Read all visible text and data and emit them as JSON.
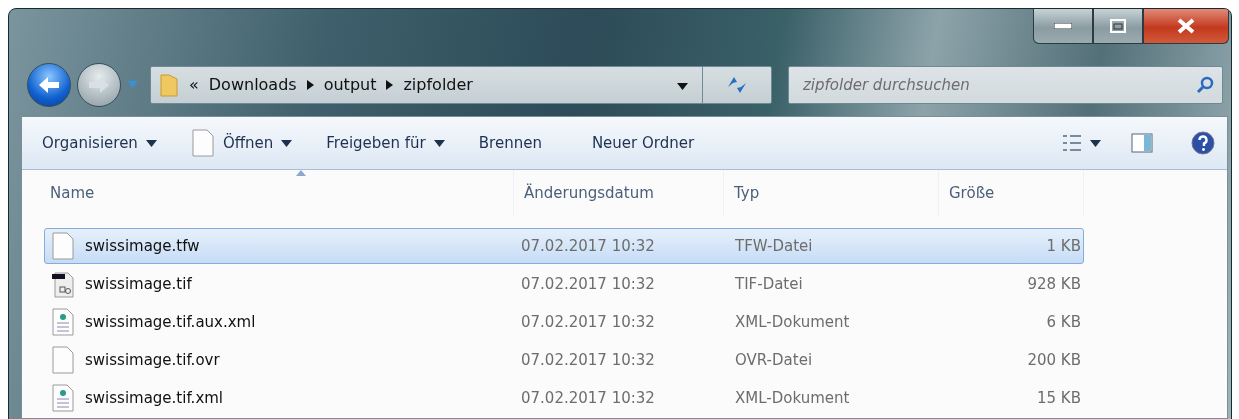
{
  "address_bar": {
    "overflow": "«",
    "path": [
      "Downloads",
      "output",
      "zipfolder"
    ]
  },
  "search": {
    "placeholder": "zipfolder durchsuchen"
  },
  "toolbar": [
    {
      "kind": "menu",
      "label": "Organisieren"
    },
    {
      "kind": "open",
      "label": "Öffnen"
    },
    {
      "kind": "menu",
      "label": "Freigeben für"
    },
    {
      "kind": "plain",
      "label": "Brennen"
    },
    {
      "kind": "plain",
      "label": "Neuer Ordner"
    }
  ],
  "table": {
    "columns": [
      "Name",
      "Änderungsdatum",
      "Typ",
      "Größe"
    ],
    "rows": [
      {
        "kind": "blank",
        "name": "swissimage.tfw",
        "date": "07.02.2017 10:32",
        "type": "TFW-Datei",
        "size": "1 KB",
        "selected": true
      },
      {
        "kind": "image",
        "name": "swissimage.tif",
        "date": "07.02.2017 10:32",
        "type": "TIF-Datei",
        "size": "928 KB",
        "selected": false
      },
      {
        "kind": "xml",
        "name": "swissimage.tif.aux.xml",
        "date": "07.02.2017 10:32",
        "type": "XML-Dokument",
        "size": "6 KB",
        "selected": false
      },
      {
        "kind": "blank",
        "name": "swissimage.tif.ovr",
        "date": "07.02.2017 10:32",
        "type": "OVR-Datei",
        "size": "200 KB",
        "selected": false
      },
      {
        "kind": "xml",
        "name": "swissimage.tif.xml",
        "date": "07.02.2017 10:32",
        "type": "XML-Dokument",
        "size": "15 KB",
        "selected": false
      }
    ]
  }
}
